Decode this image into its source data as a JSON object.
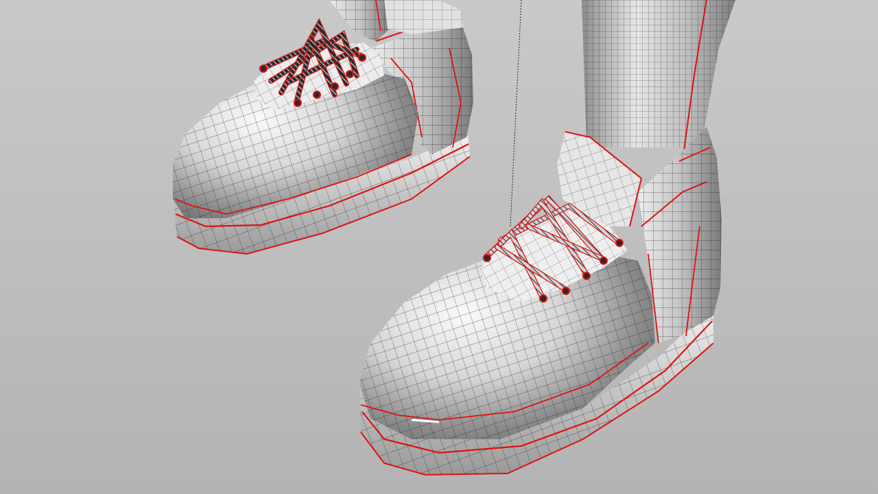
{
  "viewport": {
    "mode": "shaded-wireframe",
    "subject": "cartoon-shoes-3d-model"
  },
  "colors": {
    "background_top": "#c9c9c9",
    "background_bottom": "#b4b4b4",
    "mesh_light": "#f4f4f4",
    "mesh_mid": "#b8b8b8",
    "mesh_dark": "#6e6e6e",
    "wire": "#1a1a1a",
    "edge_highlight": "#e01010",
    "lace_dark": "#222222",
    "lace_light": "#cfcfcf"
  },
  "icons": {
    "construction_line": "dotted-line-icon"
  }
}
